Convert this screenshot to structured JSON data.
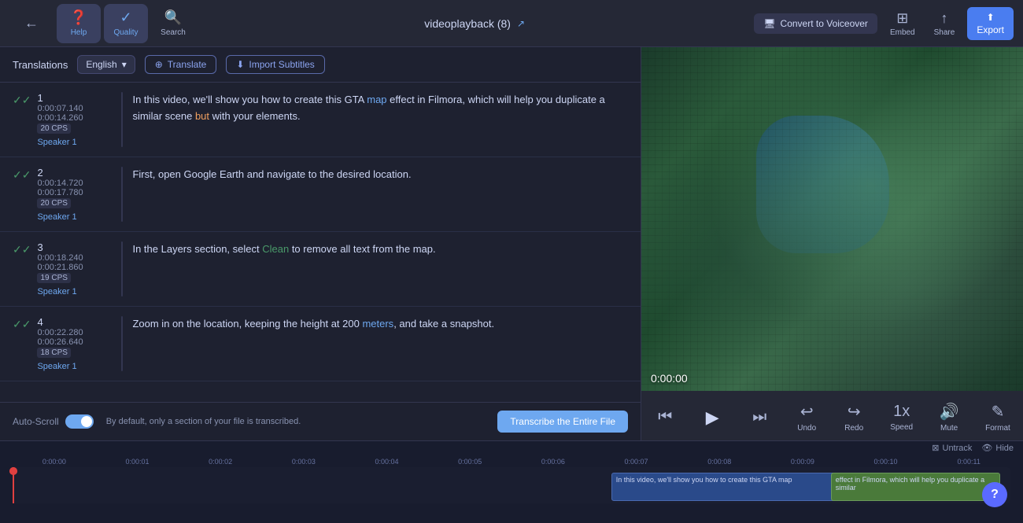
{
  "toolbar": {
    "back_icon": "←",
    "help_label": "Help",
    "quality_label": "Quality",
    "search_label": "Search",
    "title": "videoplayback (8)",
    "title_link_icon": "↗",
    "convert_label": "Convert to\nVoiceover",
    "embed_label": "Embed",
    "share_label": "Share",
    "export_label": "Export"
  },
  "translations": {
    "label": "Translations",
    "language": "English",
    "translate_btn": "Translate",
    "import_btn": "Import Subtitles"
  },
  "subtitles": [
    {
      "id": 1,
      "start": "0:00:07.140",
      "end": "0:00:14.260",
      "cps": "20 CPS",
      "speaker": "Speaker 1",
      "text": "In this video, we'll show you how to create this GTA map effect in Filmora, which will help you duplicate a similar scene but with your elements.",
      "highlights": [
        {
          "word": "map",
          "color": "blue"
        },
        {
          "word": "but",
          "color": "orange"
        }
      ]
    },
    {
      "id": 2,
      "start": "0:00:14.720",
      "end": "0:00:17.780",
      "cps": "20 CPS",
      "speaker": "Speaker 1",
      "text": "First, open Google Earth and navigate to the desired location.",
      "highlights": []
    },
    {
      "id": 3,
      "start": "0:00:18.240",
      "end": "0:00:21.860",
      "cps": "19 CPS",
      "speaker": "Speaker 1",
      "text": "In the Layers section, select Clean to remove all text from the map.",
      "highlights": [
        {
          "word": "Clean",
          "color": "green"
        }
      ]
    },
    {
      "id": 4,
      "start": "0:00:22.280",
      "end": "0:00:26.640",
      "cps": "18 CPS",
      "speaker": "Speaker 1",
      "text": "Zoom in on the location, keeping the height at 200 meters, and take a snapshot.",
      "highlights": [
        {
          "word": "meters",
          "color": "blue"
        }
      ]
    }
  ],
  "transcribe_bar": {
    "auto_scroll": "Auto-Scroll",
    "note": "By default, only a section of your file is transcribed.",
    "btn": "Transcribe the Entire File"
  },
  "video": {
    "time": "0:00:00",
    "controls": {
      "rewind": "⏮",
      "play": "▶",
      "forward": "⏭",
      "undo_icon": "↩",
      "undo_label": "Undo",
      "redo_icon": "↪",
      "redo_label": "Redo",
      "speed_label": "Speed",
      "speed_value": "1x",
      "mute_label": "Mute",
      "format_label": "Format"
    }
  },
  "timeline": {
    "markers": [
      "0:00:00",
      "0:00:01",
      "0:00:02",
      "0:00:03",
      "0:00:04",
      "0:00:05",
      "0:00:06",
      "0:00:07",
      "0:00:08",
      "0:00:09",
      "0:00:10",
      "0:00:11"
    ],
    "untrack_btn": "Untrack",
    "hide_btn": "Hide",
    "clip1_text": "In this video, we'll show you how to create this GTA map",
    "clip2_text": "effect in Filmora, which will help you duplicate a similar"
  },
  "help_btn": "?"
}
